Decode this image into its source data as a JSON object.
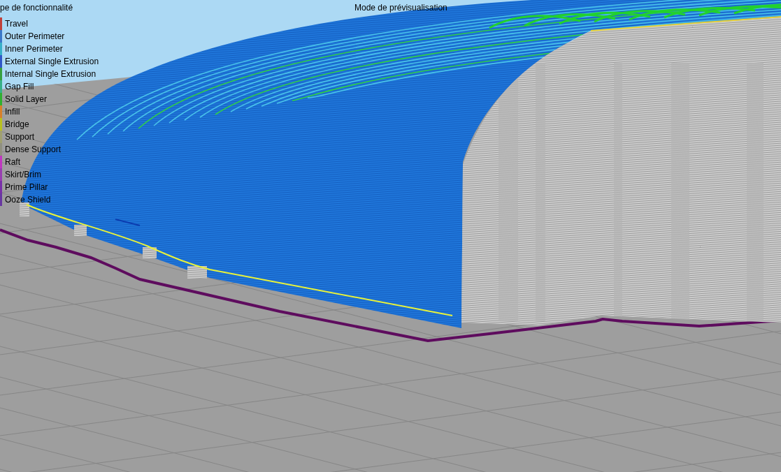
{
  "viewport": {
    "title": "Mode de prévisualisation"
  },
  "legend": {
    "title": "pe de fonctionnalité",
    "items": [
      {
        "label": "Travel",
        "color": "#c0403a"
      },
      {
        "label": "Outer Perimeter",
        "color": "#3a78c8"
      },
      {
        "label": "Inner Perimeter",
        "color": "#38b0c8"
      },
      {
        "label": "External Single Extrusion",
        "color": "#3058c8"
      },
      {
        "label": "Internal Single Extrusion",
        "color": "#38a040"
      },
      {
        "label": "Gap Fill",
        "color": "#38b088"
      },
      {
        "label": "Solid Layer",
        "color": "#30b030"
      },
      {
        "label": "Infill",
        "color": "#d8802a"
      },
      {
        "label": "Bridge",
        "color": "#b8c020"
      },
      {
        "label": "Support",
        "color": "#a0a070"
      },
      {
        "label": "Dense Support",
        "color": "#909080"
      },
      {
        "label": "Raft",
        "color": "#c038c0"
      },
      {
        "label": "Skirt/Brim",
        "color": "#9840b0"
      },
      {
        "label": "Prime Pillar",
        "color": "#7830a8"
      },
      {
        "label": "Ooze Shield",
        "color": "#6838a0"
      }
    ]
  }
}
